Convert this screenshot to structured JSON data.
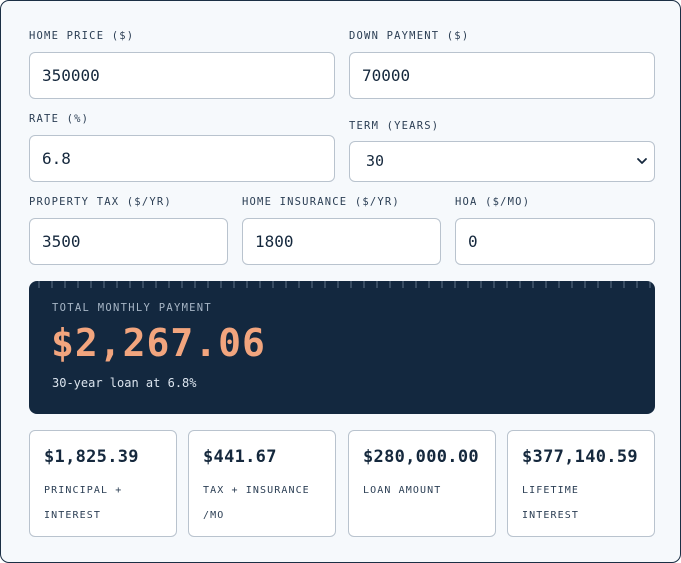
{
  "form": {
    "home_price": {
      "label": "HOME PRICE ($)",
      "value": "350000"
    },
    "down_payment": {
      "label": "DOWN PAYMENT ($)",
      "value": "70000"
    },
    "rate": {
      "label": "RATE (%)",
      "value": "6.8"
    },
    "term": {
      "label": "TERM (YEARS)",
      "value": "30",
      "icon": "chevron-down-icon"
    },
    "property_tax": {
      "label": "PROPERTY TAX ($/YR)",
      "value": "3500"
    },
    "home_insurance": {
      "label": "HOME INSURANCE ($/YR)",
      "value": "1800"
    },
    "hoa": {
      "label": "HOA ($/MO)",
      "value": "0"
    }
  },
  "summary": {
    "label": "TOTAL MONTHLY PAYMENT",
    "amount": "$2,267.06",
    "subtitle": "30-year loan at 6.8%"
  },
  "stats": [
    {
      "value": "$1,825.39",
      "label": "PRINCIPAL + INTEREST"
    },
    {
      "value": "$441.67",
      "label": "TAX + INSURANCE /MO"
    },
    {
      "value": "$280,000.00",
      "label": "LOAN AMOUNT"
    },
    {
      "value": "$377,140.59",
      "label": "LIFETIME INTEREST"
    }
  ],
  "colors": {
    "panel": "#13283f",
    "accent": "#f2a57e",
    "background": "#f6f9fc",
    "text": "#15283d"
  }
}
